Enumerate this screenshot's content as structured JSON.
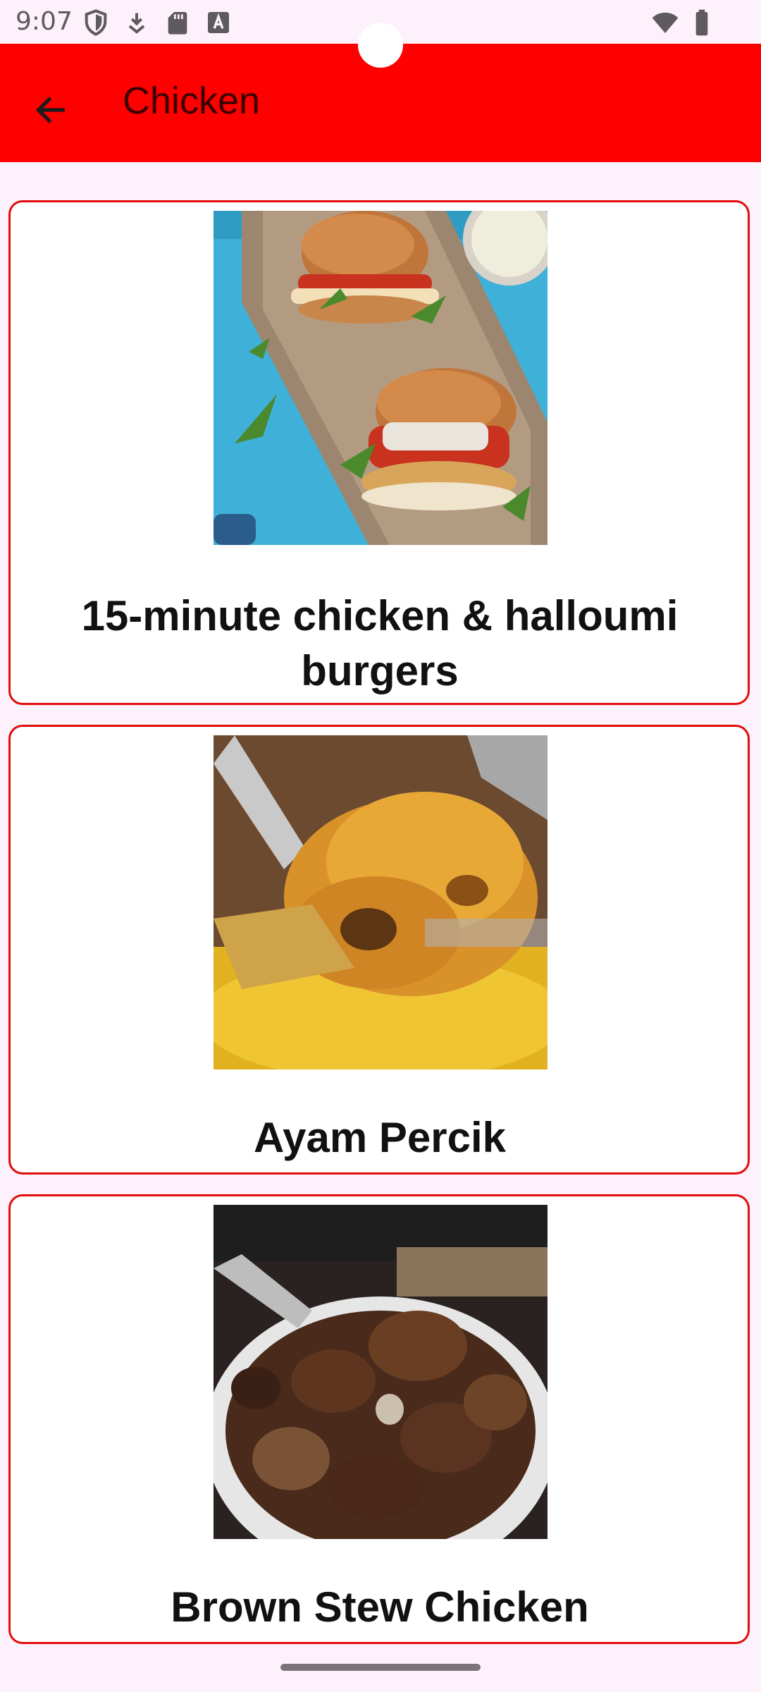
{
  "status_bar": {
    "time": "9:07",
    "icons": [
      "shield-icon",
      "download-icon",
      "sd-card-icon",
      "font-a-icon",
      "wifi-icon",
      "battery-icon"
    ]
  },
  "app_bar": {
    "title": "Chicken",
    "back_icon": "arrow-left-icon",
    "background": "#ff0000"
  },
  "recipes": [
    {
      "title": "15-minute chicken & halloumi burgers",
      "image": "chicken halloumi burgers on wooden board"
    },
    {
      "title": "Ayam Percik",
      "image": "grilled chicken drumstick"
    },
    {
      "title": "Brown Stew Chicken",
      "image": "bowl of brown stew chicken"
    }
  ],
  "colors": {
    "accent": "#ff0000",
    "card_border": "#e20c0c",
    "background": "#fdf2fb"
  }
}
